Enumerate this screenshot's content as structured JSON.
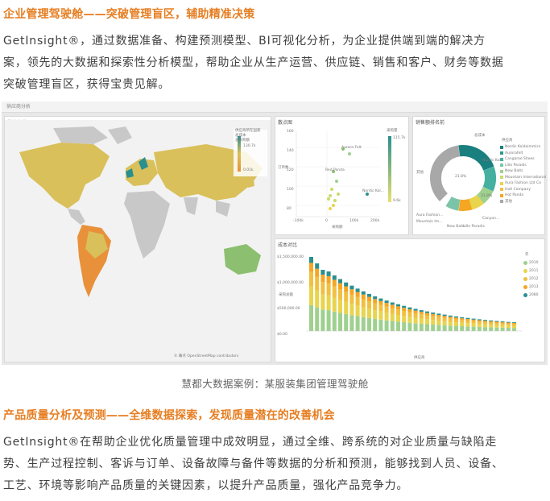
{
  "section1": {
    "heading": "企业管理驾驶舱——突破管理盲区，辅助精准决策",
    "lines": [
      "GetInsight®，通过数据准备、构建预测模型、BI可视化分析，为企业提供端到端的解决方",
      "案，领先的大数据和探索性分析模型，帮助企业从生产运营、供应链、销售和客户、财务等数据",
      "突破管理盲区，获得宝贵见解。"
    ]
  },
  "dashboard": {
    "top_title": "供应商分析",
    "map": {
      "title": "供应商地图",
      "legend_title": "供应商所在国家",
      "legend_sub": "总成本",
      "legend_label": "总采购额",
      "legend_max": "130.7k",
      "legend_min": "0.01k",
      "credit": "© 幕点  OpenStreetMap contributors",
      "colors": {
        "land": "#c8c8c8",
        "ocean": "#f2f2f2",
        "yellow": "#d9c05a",
        "orange": "#e8913a",
        "green": "#8cc070",
        "teal": "#2a8f8f"
      }
    },
    "scatter": {
      "title": "散点图",
      "ylabel": "订单数",
      "xlabel": "采购额",
      "legend_title": "采购量",
      "legend_max": "115.7k",
      "legend_min": "9.6k",
      "yticks": [
        "160",
        "140",
        "120",
        "100",
        "80",
        "60"
      ],
      "xticks": [
        "-100k",
        "0",
        "100k",
        "200k"
      ],
      "point_labels": [
        "Aurora Felt",
        "Red Panda",
        "Nordic Kol..."
      ]
    },
    "donut": {
      "title": "销售额排名前",
      "center_label": "总成本",
      "pct_a": "21.8%",
      "pct_b": "21.8%",
      "legend_title": "供应商",
      "labels": [
        "其他",
        "Nordic Koi...",
        "Canyon...",
        "Lille Paradis",
        "New Balts",
        "Aura Fashion...",
        "Mountain Im..."
      ],
      "legend": [
        "Nordic Koidoimmics",
        "Aurorafelt",
        "Cangaroo Shoes",
        "Lillo Paradis",
        "New Balts",
        "Mountain International",
        "Aura Fashion Ltd Co",
        "Hotl Company",
        "Hot Panda",
        "其他"
      ],
      "colors": [
        "#1a7f7f",
        "#2e9a8e",
        "#45b0a0",
        "#7cc4a8",
        "#9fd08f",
        "#c9dc6a",
        "#e8d44d",
        "#f0c040",
        "#f5a623",
        "#a8a8a8"
      ]
    },
    "bar": {
      "title": "成本对比",
      "legend_title": "年",
      "years": [
        "2010",
        "2011",
        "2012",
        "2013",
        "2080"
      ],
      "year_colors": [
        "#9fd08f",
        "#e8d44d",
        "#f0c040",
        "#f5a623",
        "#2a8f8f"
      ],
      "yticks": [
        "$1,500,000.00",
        "$1,000,000.00",
        "$500,000.00",
        "$0.00"
      ],
      "ylabel": "采购总额",
      "xlabel": "供应商"
    }
  },
  "caption": "慧都大数据案例：某服装集团管理驾驶舱",
  "section2": {
    "heading": "产品质量分析及预测——全维数据探索，发现质量潜在的改善机会",
    "lines": [
      "GetInsight®在帮助企业优化质量管理中成效明显，通过全维、跨系统的对企业质量与缺陷走",
      "势、生产过程控制、客诉与订单、设备故障与备件等数据的分析和预测，能够找到人员、设备、",
      "工艺、环境等影响产品质量的关键因素，以提升产品质量，强化产品竞争力。"
    ]
  }
}
